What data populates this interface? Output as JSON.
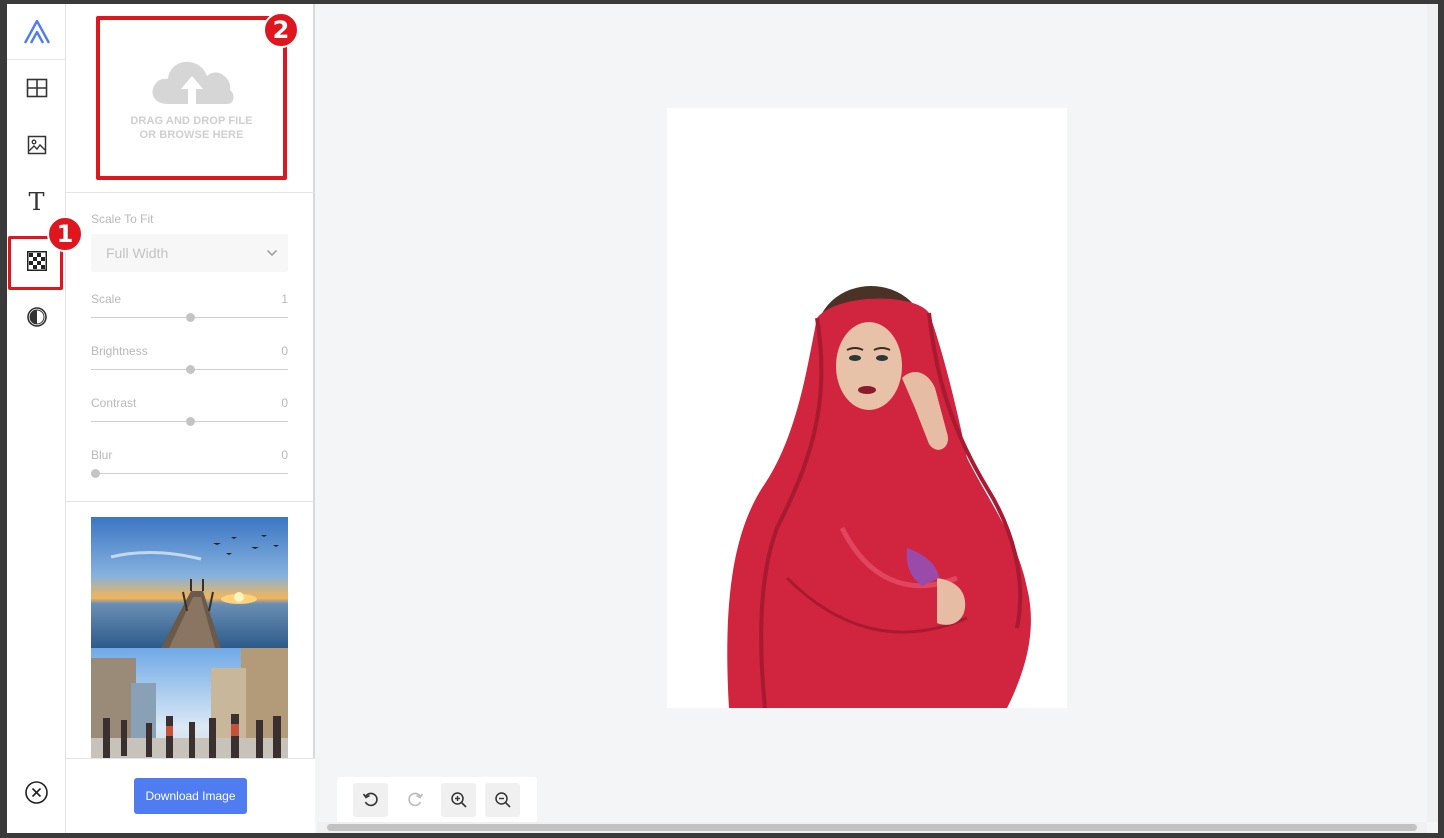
{
  "rail": {
    "logo_icon": "app-logo-icon",
    "tools": [
      {
        "icon": "grid-layout-icon"
      },
      {
        "icon": "image-icon"
      },
      {
        "icon": "text-icon",
        "glyph": "T"
      },
      {
        "icon": "checkerboard-background-icon",
        "active": true
      },
      {
        "icon": "contrast-filter-icon"
      }
    ],
    "close_icon": "close-circle-icon"
  },
  "callouts": {
    "step1": "1",
    "step2": "2",
    "color": "#e0161f"
  },
  "upload": {
    "line1": "DRAG AND DROP FILE",
    "line2": "OR BROWSE HERE"
  },
  "controls": {
    "scale_to_fit_label": "Scale To Fit",
    "scale_to_fit_value": "Full Width",
    "sliders": [
      {
        "label": "Scale",
        "value": "1",
        "fraction": 0.5
      },
      {
        "label": "Brightness",
        "value": "0",
        "fraction": 0.5
      },
      {
        "label": "Contrast",
        "value": "0",
        "fraction": 0.5
      },
      {
        "label": "Blur",
        "value": "0",
        "fraction": 0.0
      }
    ]
  },
  "gallery": [
    {
      "name": "sunset-pier-photo"
    },
    {
      "name": "city-crowd-photo"
    }
  ],
  "download_label": "Download Image",
  "toolbar": [
    {
      "icon": "undo-icon",
      "enabled": true
    },
    {
      "icon": "redo-icon",
      "enabled": false
    },
    {
      "icon": "zoom-in-icon",
      "enabled": true
    },
    {
      "icon": "zoom-out-icon",
      "enabled": true
    }
  ],
  "colors": {
    "accent": "#4f7cf0",
    "highlight": "#e0161f"
  }
}
